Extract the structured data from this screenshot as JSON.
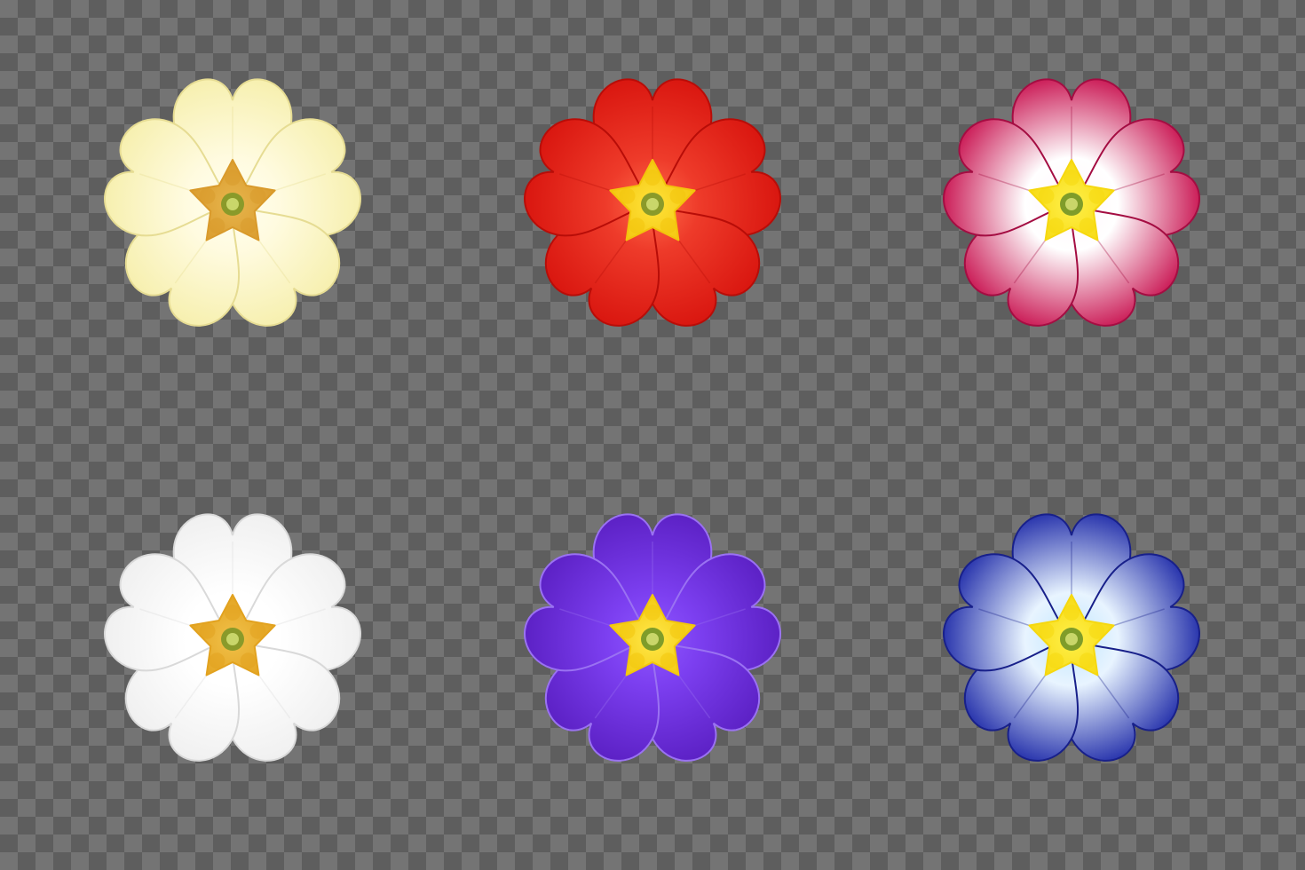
{
  "flowers": [
    {
      "name": "pale-yellow-primrose",
      "outer": "#f6efac",
      "inner": "#fffbe0",
      "edge": "#e6dc93",
      "star": "#d99a2b",
      "star_light": "#e7b54d",
      "pistil": "#8a9a2a",
      "glow": "#fffef0"
    },
    {
      "name": "red-primrose",
      "outer": "#d8140e",
      "inner": "#ee3b2a",
      "edge": "#b80d08",
      "star": "#f3c40c",
      "star_light": "#ffe23a",
      "pistil": "#8a9a2a",
      "glow": "#ff6a4a"
    },
    {
      "name": "magenta-white-primrose",
      "outer": "#c8104e",
      "inner": "#ffffff",
      "edge": "#a40d42",
      "star": "#f6d80f",
      "star_light": "#fff04a",
      "pistil": "#7f9c2a",
      "glow": "#fff4fa"
    },
    {
      "name": "white-primrose",
      "outer": "#efefef",
      "inner": "#ffffff",
      "edge": "#d9d9d9",
      "star": "#e2a21f",
      "star_light": "#f1c14a",
      "pistil": "#8a9a2a",
      "glow": "#ffffff"
    },
    {
      "name": "violet-primrose",
      "outer": "#5a1fc2",
      "inner": "#7c3ff0",
      "edge": "#9a72f2",
      "star": "#f3c70c",
      "star_light": "#ffe84a",
      "pistil": "#7f9c2a",
      "glow": "#8e57ff"
    },
    {
      "name": "blue-primrose",
      "outer": "#1e2aa8",
      "inner": "#e8f4ff",
      "edge": "#18208a",
      "star": "#f6d80f",
      "star_light": "#fff04a",
      "pistil": "#7f9c2a",
      "glow": "#bfe6ff"
    }
  ]
}
